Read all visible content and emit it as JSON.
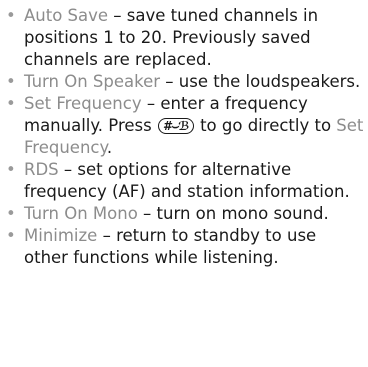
{
  "items": [
    {
      "term": "Auto Save",
      "desc": " – save tuned channels in positions 1 to 20. Previously saved channels are replaced."
    },
    {
      "term": "Turn On Speaker",
      "desc": " – use the loudspeakers."
    },
    {
      "term": "Set Frequency",
      "desc_a": " – enter a frequency manually. Press ",
      "key_label": "#⌣ℬ",
      "desc_b": " to go directly to ",
      "term2": "Set Frequency",
      "desc_c": "."
    },
    {
      "term": "RDS",
      "desc": " – set options for alternative frequency (AF) and station information."
    },
    {
      "term": "Turn On Mono",
      "desc": " – turn on mono sound."
    },
    {
      "term": "Minimize",
      "desc": " – return to standby to use other functions while listening."
    }
  ],
  "colors": {
    "term": "#8c8c8c",
    "text": "#1a1a1a",
    "bullet": "#9a9a9a"
  }
}
